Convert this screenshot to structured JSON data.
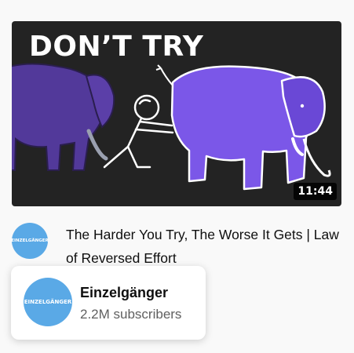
{
  "thumbnail": {
    "headline": "DON’T TRY",
    "duration": "11:44"
  },
  "video": {
    "title": "The Harder You Try, The Worse It Gets | Law of Reversed Effort"
  },
  "channel": {
    "avatar_text": "EINZELGÄNGER",
    "name": "Einzelgänger",
    "subscribers": "2.2M subscribers"
  },
  "colors": {
    "avatar_bg": "#5aa9e6",
    "elephant": "#7b57e8",
    "elephant_shadow": "#52399a",
    "thumbnail_bg": "#232323"
  }
}
